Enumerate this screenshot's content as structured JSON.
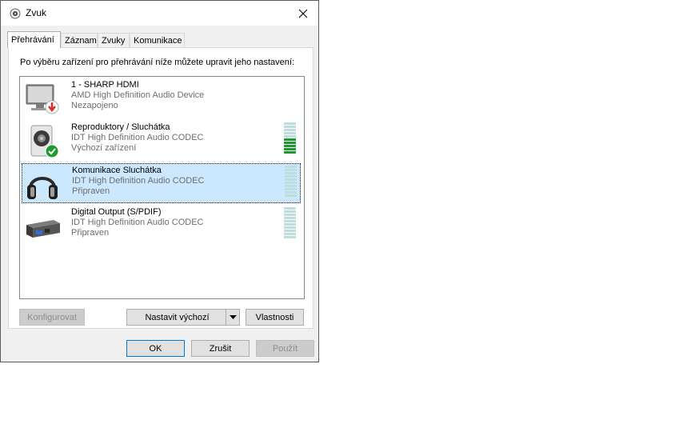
{
  "window": {
    "title": "Zvuk"
  },
  "tabs": [
    {
      "label": "Přehrávání",
      "active": true
    },
    {
      "label": "Záznam"
    },
    {
      "label": "Zvuky"
    },
    {
      "label": "Komunikace"
    }
  ],
  "instruction": "Po výběru zařízení pro přehrávání níže můžete upravit jeho nastavení:",
  "devices": [
    {
      "name": "1 - SHARP HDMI",
      "driver": "AMD High Definition Audio Device",
      "status": "Nezapojeno",
      "icon": "monitor-icon",
      "badge": "disconnected-arrow-icon"
    },
    {
      "name": "Reproduktory / Sluchátka",
      "driver": "IDT High Definition Audio CODEC",
      "status": "Výchozí zařízení",
      "icon": "speaker-icon",
      "badge": "default-check-icon",
      "level": 0.5
    },
    {
      "name": "Komunikace Sluchátka",
      "driver": "IDT High Definition Audio CODEC",
      "status": "Připraven",
      "icon": "headphones-icon",
      "selected": true,
      "level": 0
    },
    {
      "name": "Digital Output (S/PDIF)",
      "driver": "IDT High Definition Audio CODEC",
      "status": "Připraven",
      "icon": "spdif-icon",
      "level": 0
    }
  ],
  "buttons": {
    "configure": "Konfigurovat",
    "set_default": "Nastavit výchozí",
    "properties": "Vlastnosti",
    "ok": "OK",
    "cancel": "Zrušit",
    "apply": "Použít"
  },
  "colors": {
    "selection": "#cce8ff",
    "meter_on": "#1e9a30",
    "meter_off": "#bdddde",
    "accent": "#0078d7"
  }
}
